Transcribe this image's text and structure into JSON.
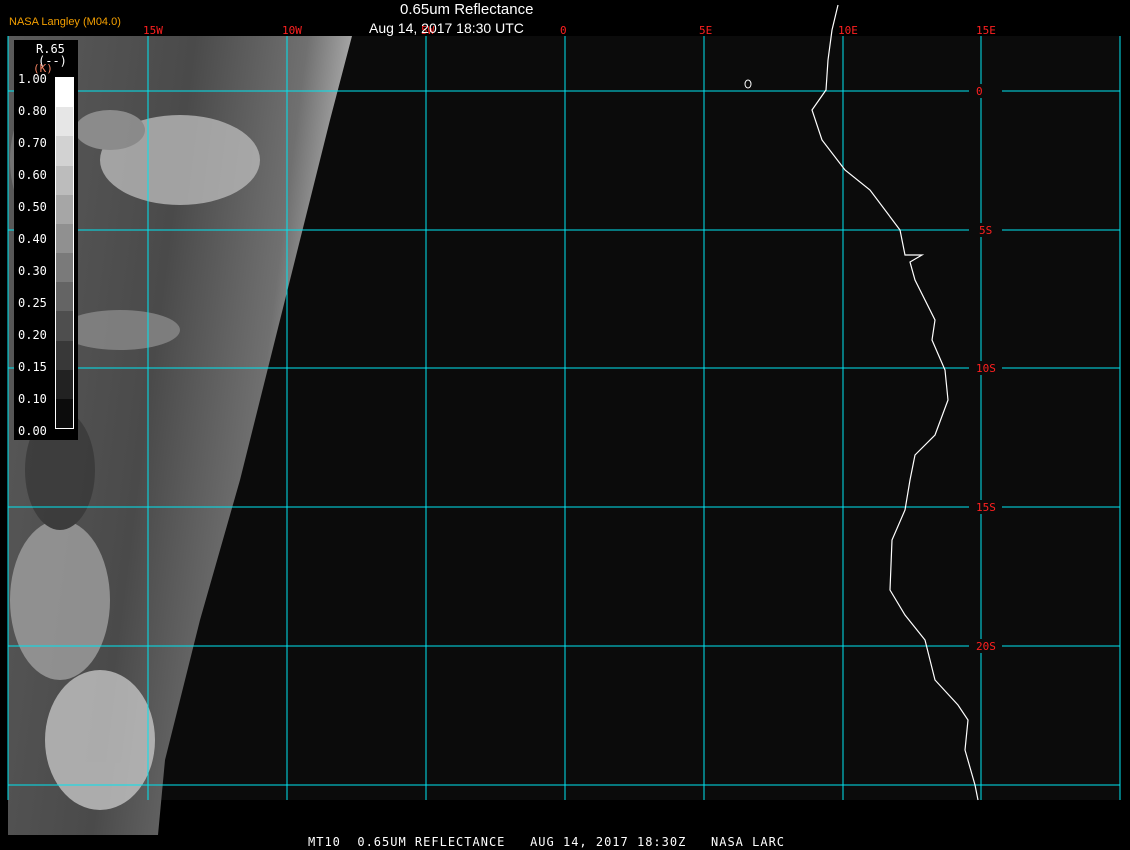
{
  "header": {
    "title": "0.65um Reflectance",
    "subtitle": "Aug 14, 2017 18:30 UTC",
    "credit": "NASA Langley (M04.0)"
  },
  "footer": {
    "text": "MT10  0.65UM REFLECTANCE   AUG 14, 2017 18:30Z   NASA LARC"
  },
  "colorbar": {
    "variable": "R.65",
    "units": "(--)",
    "units2": "(K)",
    "labels": [
      "1.00",
      "0.80",
      "0.70",
      "0.60",
      "0.50",
      "0.40",
      "0.30",
      "0.25",
      "0.20",
      "0.15",
      "0.10",
      "0.00"
    ],
    "colors": [
      "#ffffff",
      "#e6e6e6",
      "#d2d2d2",
      "#bcbcbc",
      "#a6a6a6",
      "#909090",
      "#7a7a7a",
      "#646464",
      "#4e4e4e",
      "#383838",
      "#222222",
      "#0c0c0c"
    ]
  },
  "grid": {
    "longitude_labels": [
      "15W",
      "10W",
      "5W",
      "0",
      "5E",
      "10E",
      "15E"
    ],
    "latitude_labels": [
      "0",
      "5S",
      "10S",
      "15S",
      "20S"
    ],
    "line_color": "#00e5f0",
    "label_color": "#ff2020"
  },
  "colors": {
    "background": "#0b0b0b",
    "coastline": "#ffffff"
  }
}
